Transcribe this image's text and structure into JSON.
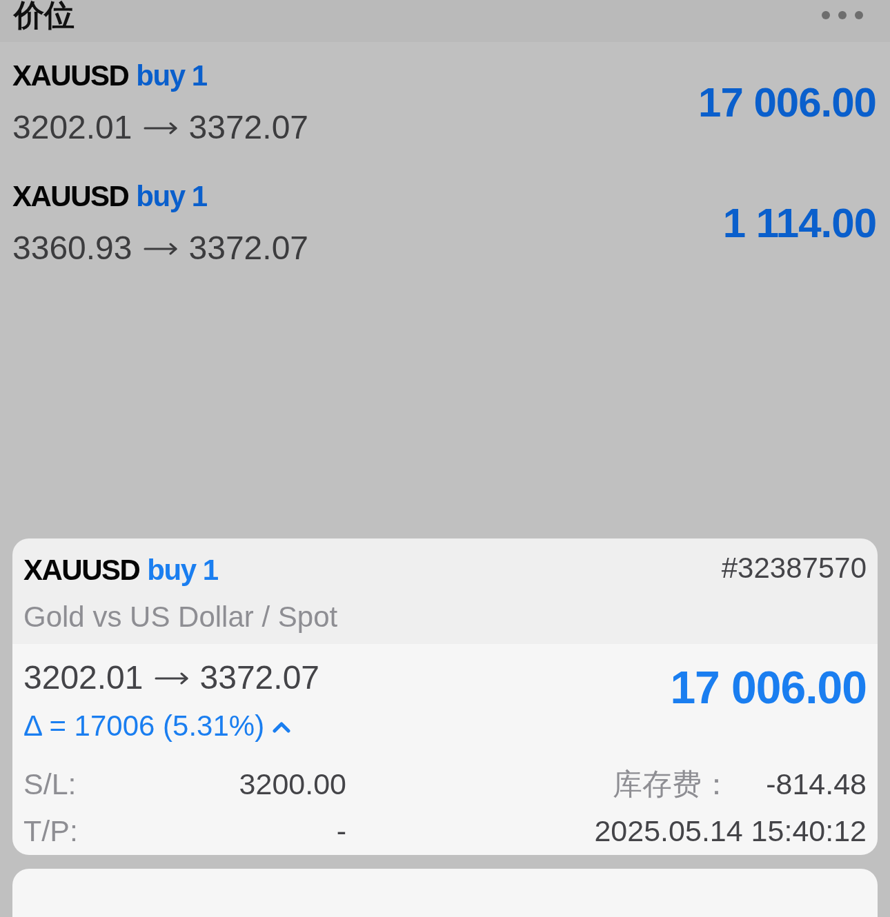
{
  "header": {
    "title": "价位"
  },
  "positions": [
    {
      "symbol": "XAUUSD",
      "trade": "buy 1",
      "open_price": "3202.01",
      "current_price": "3372.07",
      "profit": "17 006.00"
    },
    {
      "symbol": "XAUUSD",
      "trade": "buy 1",
      "open_price": "3360.93",
      "current_price": "3372.07",
      "profit": "1 114.00"
    }
  ],
  "detail": {
    "symbol": "XAUUSD",
    "trade": "buy 1",
    "ticket": "#32387570",
    "description": "Gold vs US Dollar / Spot",
    "open_price": "3202.01",
    "current_price": "3372.07",
    "change": "Δ = 17006 (5.31%)",
    "rising": true,
    "profit": "17 006.00",
    "stop_loss": {
      "label": "S/L:",
      "value": "3200.00"
    },
    "swap": {
      "label": "库存费：",
      "value": "-814.48"
    },
    "take_profit": {
      "label": "T/P:",
      "value": "-"
    },
    "open_time": "2025.05.14 15:40:12"
  }
}
